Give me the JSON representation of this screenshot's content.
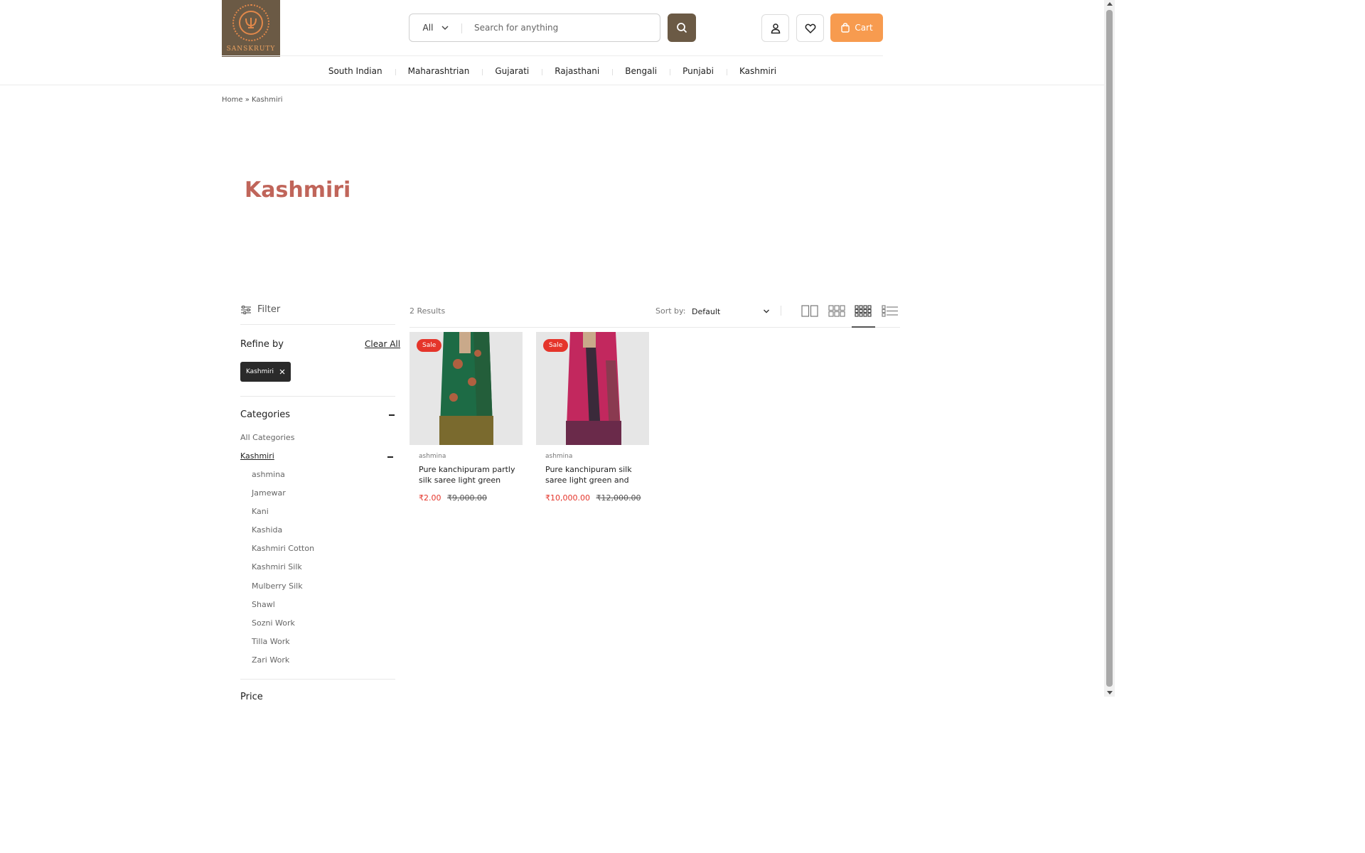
{
  "brand": {
    "logo_text": "SANSKRUTY",
    "accent_color": "#6b5a45",
    "cart_color": "#f79b4f"
  },
  "search": {
    "category": "All",
    "placeholder": "Search for anything",
    "icon": "search-icon"
  },
  "header": {
    "account_icon": "user-icon",
    "wishlist_icon": "heart-icon",
    "cart_label": "Cart",
    "cart_icon": "bag-icon"
  },
  "nav": {
    "items": [
      "South Indian",
      "Maharashtrian",
      "Gujarati",
      "Rajasthani",
      "Bengali",
      "Punjabi",
      "Kashmiri"
    ]
  },
  "breadcrumb": {
    "home": "Home",
    "separator": "»",
    "current": "Kashmiri"
  },
  "page": {
    "title": "Kashmiri",
    "title_color": "#c0655a"
  },
  "sidebar": {
    "filter_label": "Filter",
    "refine_label": "Refine by",
    "clear_all": "Clear All",
    "active_filter": "Kashmiri",
    "categories_title": "Categories",
    "all_categories": "All Categories",
    "selected_category": "Kashmiri",
    "subcategories": [
      "ashmina",
      "Jamewar",
      "Kani",
      "Kashida",
      "Kashmiri Cotton",
      "Kashmiri Silk",
      "Mulberry Silk",
      "Shawl",
      "Sozni Work",
      "Tilla Work",
      "Zari Work"
    ],
    "next_section": "Price"
  },
  "toolbar": {
    "results": "2 Results",
    "sort_label": "Sort by:",
    "sort_value": "Default",
    "view_modes": [
      "grid-2-icon",
      "grid-3-icon",
      "grid-4-icon",
      "list-icon"
    ],
    "active_view": "grid-4-icon"
  },
  "products": [
    {
      "badge": "Sale",
      "brand": "ashmina",
      "title": "Pure kanchipuram partly silk saree light green and",
      "sale_price": "₹2.00",
      "regular_price": "₹9,000.00",
      "saree_color": "#1d6b45",
      "border_color": "#7a6a2e"
    },
    {
      "badge": "Sale",
      "brand": "ashmina",
      "title": "Pure kanchipuram silk saree light green and",
      "sale_price": "₹10,000.00",
      "regular_price": "₹12,000.00",
      "saree_color": "#c2285e",
      "border_color": "#6a2a4a"
    }
  ]
}
